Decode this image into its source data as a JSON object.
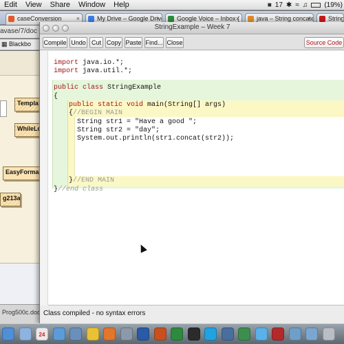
{
  "menubar": {
    "items": [
      "Edit",
      "View",
      "Share",
      "Window",
      "Help"
    ],
    "status": {
      "calendar": "17",
      "battery": "(19%)"
    }
  },
  "browser": {
    "tabs": [
      {
        "label": "caseConversion",
        "color": "#e05a2b"
      },
      {
        "label": "My Drive – Google Drive",
        "color": "#3b7de3"
      },
      {
        "label": "Google Voice – Inbox (",
        "color": "#2f8a3b"
      },
      {
        "label": "java – String concaten",
        "color": "#e08a2b"
      },
      {
        "label": "String (Ja",
        "color": "#c8181b"
      }
    ],
    "url_fragment": "avase/7/doc",
    "bookmark": "Blackbo"
  },
  "bluej": {
    "classes": [
      "Templa",
      "WhileLo",
      "EasyForma",
      "g213a"
    ],
    "file": "Prog500c.doc"
  },
  "editor": {
    "title": "StringExample – Week 7",
    "toolbar": {
      "compile": "Compile",
      "undo": "Undo",
      "cut": "Cut",
      "copy": "Copy",
      "paste": "Paste",
      "find": "Find...",
      "close": "Close",
      "view": "Source Code"
    },
    "code": {
      "import1_kw": "import",
      "import1_rest": " java.io.*;",
      "import2_kw": "import",
      "import2_rest": " java.util.*;",
      "class_kw": "public class",
      "class_rest": " StringExample",
      "open_brace": "{",
      "method_kw": "public static void",
      "method_rest": " main(String[] args)",
      "begin_brace": "{",
      "begin_comment": "//BEGIN MAIN",
      "line_str1": "String str1 = \"Have a good \";",
      "line_str2": "String str2 = \"day\";",
      "line_print": "System.out.println(str1.concat(str2));",
      "end_brace": "}",
      "end_comment": "//END MAIN",
      "class_end_brace": "}",
      "class_end_comment": "//end class"
    },
    "status": "Class compiled - no syntax errors"
  },
  "dock": {
    "calendar_day": "24",
    "icons": [
      {
        "name": "finder",
        "color": "#4f8fd6"
      },
      {
        "name": "mail",
        "color": "#8db3de"
      },
      {
        "name": "calendar",
        "color": "#e9e9e9"
      },
      {
        "name": "itunes",
        "color": "#5b9bd8"
      },
      {
        "name": "iphoto",
        "color": "#6a8fb8"
      },
      {
        "name": "chrome",
        "color": "#e9c234"
      },
      {
        "name": "firefox",
        "color": "#e2762b"
      },
      {
        "name": "preview",
        "color": "#8b9aa8"
      },
      {
        "name": "word",
        "color": "#2b5aa6"
      },
      {
        "name": "powerpoint",
        "color": "#c8501e"
      },
      {
        "name": "excel",
        "color": "#2e8a3e"
      },
      {
        "name": "terminal",
        "color": "#2b2b2b"
      },
      {
        "name": "skype",
        "color": "#1fa3e3"
      },
      {
        "name": "bluej",
        "color": "#4a6e9e"
      },
      {
        "name": "camtasia",
        "color": "#3c8e4e"
      },
      {
        "name": "itunes-store",
        "color": "#5bb0e8"
      },
      {
        "name": "photobooth",
        "color": "#b32a2a"
      },
      {
        "name": "folder",
        "color": "#6f9ec7"
      },
      {
        "name": "downloads",
        "color": "#7ba6cf"
      },
      {
        "name": "trash",
        "color": "#b9bec4"
      }
    ]
  }
}
